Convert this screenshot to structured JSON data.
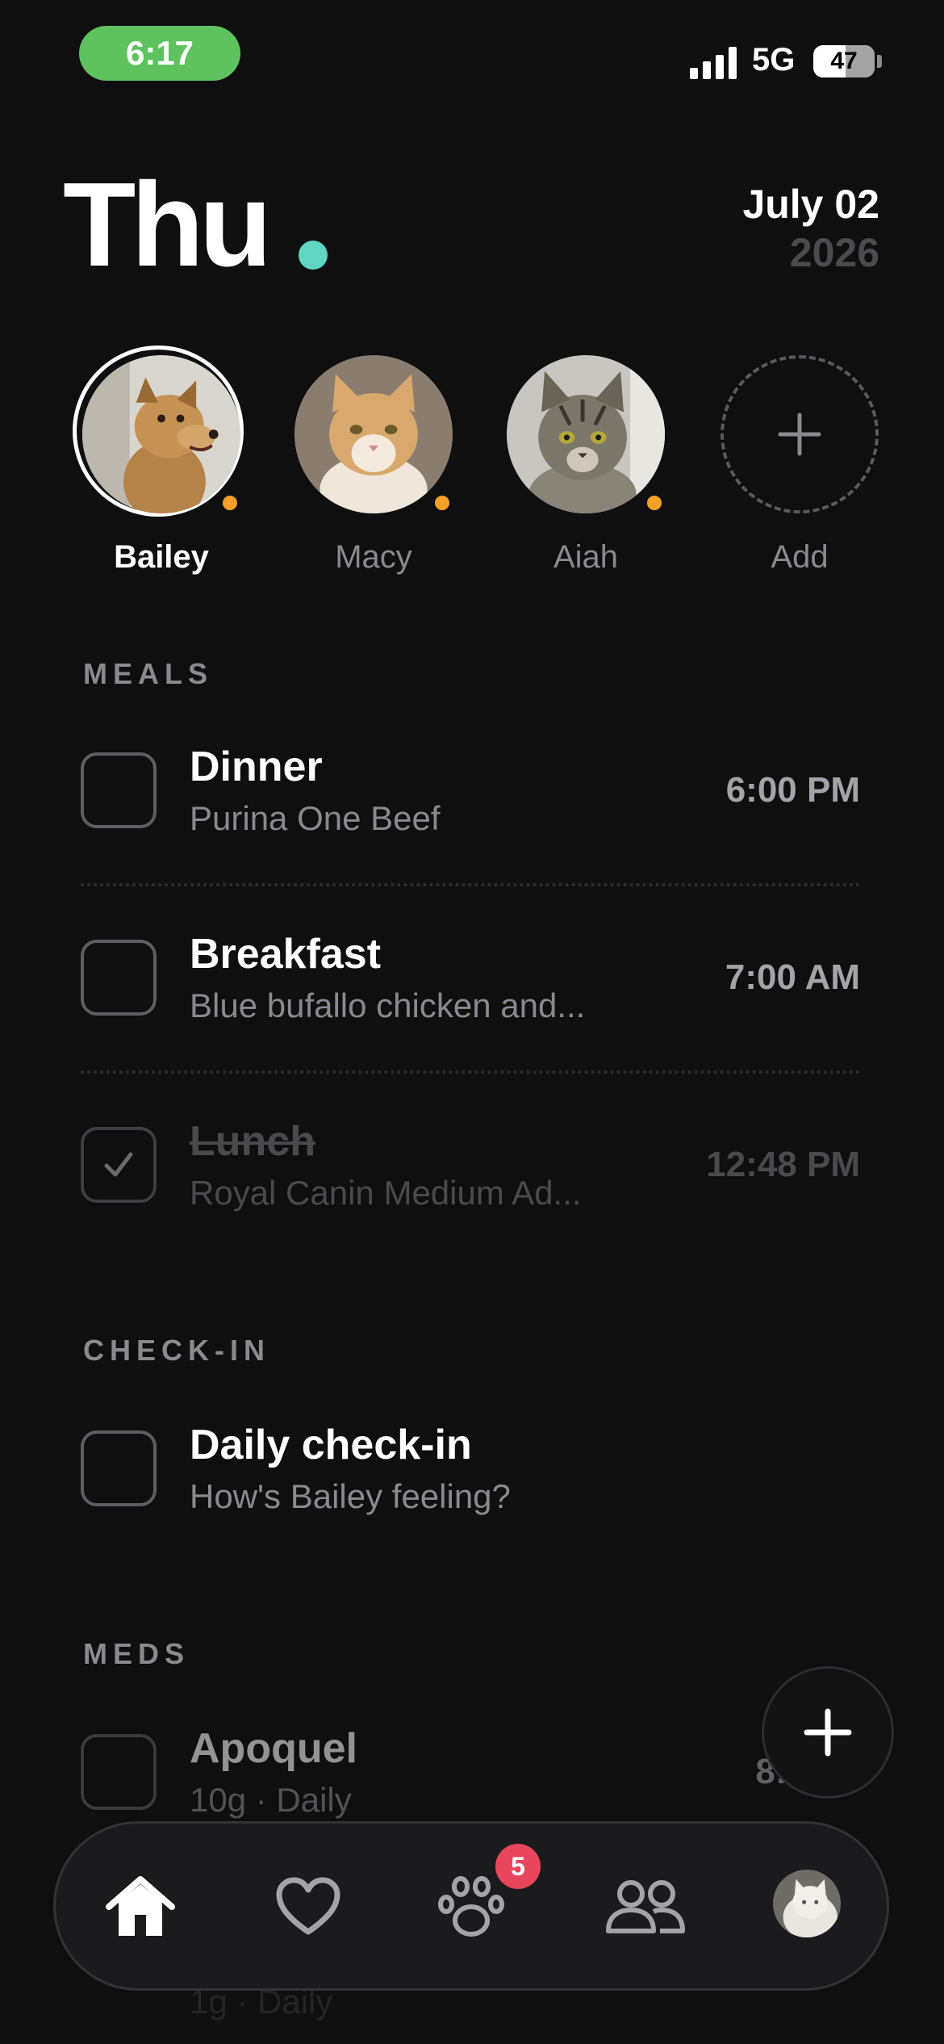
{
  "status_bar": {
    "time": "6:17",
    "network": "5G",
    "battery": "47"
  },
  "header": {
    "day": "Thu",
    "month_day": "July 02",
    "year": "2026",
    "accent_color": "#5fd6c1"
  },
  "pets": [
    {
      "name": "Bailey",
      "selected": true,
      "status_dot": "orange"
    },
    {
      "name": "Macy",
      "selected": false,
      "status_dot": "orange"
    },
    {
      "name": "Aiah",
      "selected": false,
      "status_dot": "orange"
    },
    {
      "name": "Add",
      "icon": "plus-icon"
    }
  ],
  "sections": {
    "meals": {
      "label": "MEALS",
      "items": [
        {
          "title": "Dinner",
          "subtitle": "Purina One Beef",
          "time": "6:00 PM",
          "done": false
        },
        {
          "title": "Breakfast",
          "subtitle": "Blue bufallo chicken and...",
          "time": "7:00 AM",
          "done": false
        },
        {
          "title": "Lunch",
          "subtitle": "Royal Canin Medium Ad...",
          "time": "12:48 PM",
          "done": true
        }
      ]
    },
    "checkin": {
      "label": "CHECK-IN",
      "items": [
        {
          "title": "Daily check-in",
          "subtitle": "How's Bailey feeling?",
          "done": false
        }
      ]
    },
    "meds": {
      "label": "MEDS",
      "items": [
        {
          "title": "Apoquel",
          "subtitle": "10g · Daily",
          "time": "8:0",
          "done": false
        }
      ],
      "ghost_subtitle": "1g · Daily"
    }
  },
  "tab_bar": {
    "tabs": [
      "home-icon",
      "heart-icon",
      "paw-icon",
      "people-icon",
      "profile-avatar"
    ],
    "badge": "5"
  },
  "colors": {
    "background": "#0f0f10",
    "status_pill": "#5ec25f",
    "pet_dot": "#f5a026",
    "badge": "#e8465d"
  }
}
